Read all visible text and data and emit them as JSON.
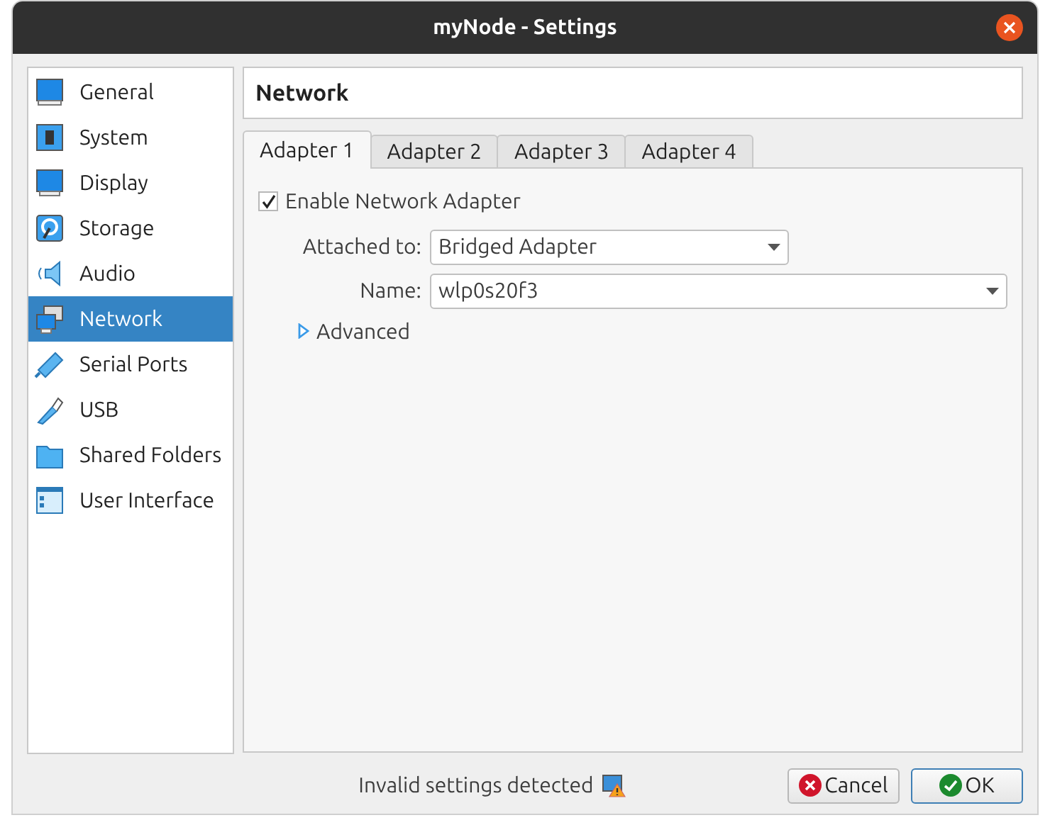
{
  "window": {
    "title": "myNode - Settings"
  },
  "sidebar": {
    "items": [
      {
        "label": "General",
        "selected": false
      },
      {
        "label": "System",
        "selected": false
      },
      {
        "label": "Display",
        "selected": false
      },
      {
        "label": "Storage",
        "selected": false
      },
      {
        "label": "Audio",
        "selected": false
      },
      {
        "label": "Network",
        "selected": true
      },
      {
        "label": "Serial Ports",
        "selected": false
      },
      {
        "label": "USB",
        "selected": false
      },
      {
        "label": "Shared Folders",
        "selected": false
      },
      {
        "label": "User Interface",
        "selected": false
      }
    ]
  },
  "page_title": "Network",
  "tabs": [
    {
      "label": "Adapter 1",
      "selected": true
    },
    {
      "label": "Adapter 2",
      "selected": false
    },
    {
      "label": "Adapter 3",
      "selected": false
    },
    {
      "label": "Adapter 4",
      "selected": false
    }
  ],
  "enable_adapter": {
    "label": "Enable Network Adapter",
    "checked": true
  },
  "attached_to": {
    "label": "Attached to:",
    "value": "Bridged Adapter"
  },
  "name": {
    "label": "Name:",
    "value": "wlp0s20f3"
  },
  "advanced": {
    "label": "Advanced",
    "expanded": false
  },
  "status": "Invalid settings detected",
  "buttons": [
    {
      "label": "Cancel",
      "kind": "cancel",
      "default": false
    },
    {
      "label": "OK",
      "kind": "ok",
      "default": true
    }
  ]
}
